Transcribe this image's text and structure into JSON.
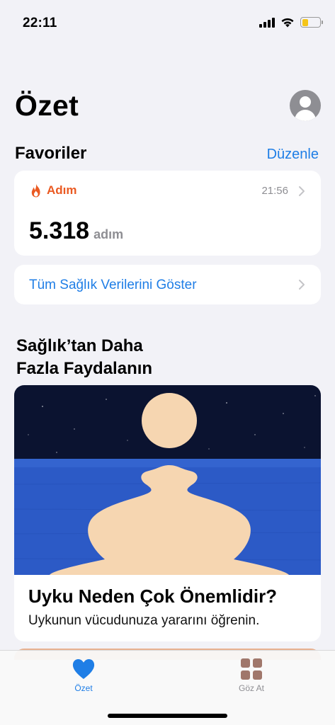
{
  "status_bar": {
    "time": "22:11",
    "battery_level": 0.35,
    "battery_color": "#f5c518"
  },
  "header": {
    "title": "Özet",
    "avatar_icon": "person-circle-icon"
  },
  "favorites": {
    "title": "Favoriler",
    "edit_label": "Düzenle",
    "steps": {
      "icon": "flame-icon",
      "label": "Adım",
      "time": "21:56",
      "value": "5.318",
      "unit": "adım"
    },
    "show_all_label": "Tüm Sağlık Verilerini Göster"
  },
  "promo": {
    "title_line1": "Sağlık’tan Daha",
    "title_line2": "Fazla Faydalanın",
    "article": {
      "title": "Uyku Neden Çok Önemlidir?",
      "subtitle": "Uykunun vücudunuza yararını öğrenin."
    }
  },
  "tab_bar": {
    "summary_label": "Özet",
    "summary_icon": "heart-icon",
    "browse_label": "Göz At",
    "browse_icon": "grid-icon"
  },
  "colors": {
    "accent": "#1f7ee6",
    "steps": "#ea5a22",
    "background": "#f2f2f7"
  }
}
